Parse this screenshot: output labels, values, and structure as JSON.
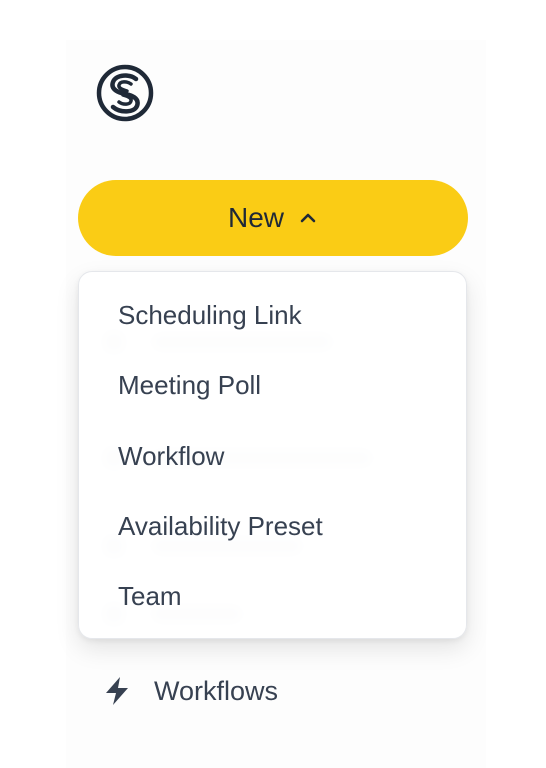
{
  "new_button": {
    "label": "New"
  },
  "dropdown": {
    "items": [
      {
        "label": "Scheduling Link"
      },
      {
        "label": "Meeting Poll"
      },
      {
        "label": "Workflow"
      },
      {
        "label": "Availability Preset"
      },
      {
        "label": "Team"
      }
    ]
  },
  "nav": {
    "items": [
      {
        "label": "Workflows",
        "icon": "bolt-icon"
      }
    ]
  },
  "colors": {
    "accent": "#facc15",
    "text": "#374151",
    "logo": "#1f2937"
  }
}
